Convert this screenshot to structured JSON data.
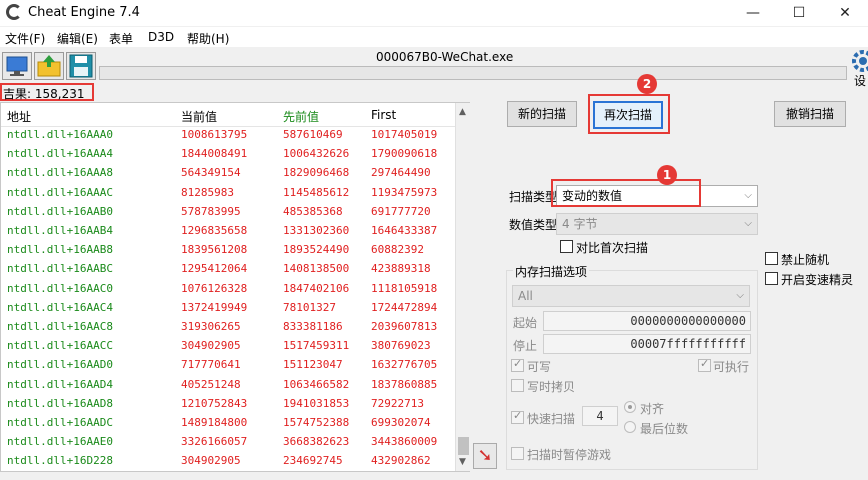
{
  "window": {
    "title": "Cheat Engine 7.4",
    "minimize": "—",
    "maximize": "☐",
    "close": "✕"
  },
  "menu": [
    "文件(F)",
    "编辑(E)",
    "表单",
    "D3D",
    "帮助(H)"
  ],
  "process_title": "000067B0-WeChat.exe",
  "settings_label": "设",
  "results_count": "吉果: 158,231",
  "table": {
    "headers": [
      "地址",
      "当前值",
      "先前值",
      "First"
    ],
    "rows": [
      [
        "ntdll.dll+16AAA0",
        "1008613795",
        "587610469",
        "1017405019"
      ],
      [
        "ntdll.dll+16AAA4",
        "1844008491",
        "1006432626",
        "1790090618"
      ],
      [
        "ntdll.dll+16AAA8",
        "564349154",
        "1829096468",
        "297464490"
      ],
      [
        "ntdll.dll+16AAAC",
        "81285983",
        "1145485612",
        "1193475973"
      ],
      [
        "ntdll.dll+16AAB0",
        "578783995",
        "485385368",
        "691777720"
      ],
      [
        "ntdll.dll+16AAB4",
        "1296835658",
        "1331302360",
        "1646433387"
      ],
      [
        "ntdll.dll+16AAB8",
        "1839561208",
        "1893524490",
        "60882392"
      ],
      [
        "ntdll.dll+16AABC",
        "1295412064",
        "1408138500",
        "423889318"
      ],
      [
        "ntdll.dll+16AAC0",
        "1076126328",
        "1847402106",
        "1118105918"
      ],
      [
        "ntdll.dll+16AAC4",
        "1372419949",
        "78101327",
        "1724472894"
      ],
      [
        "ntdll.dll+16AAC8",
        "319306265",
        "833381186",
        "2039607813"
      ],
      [
        "ntdll.dll+16AACC",
        "304902905",
        "1517459311",
        "380769023"
      ],
      [
        "ntdll.dll+16AAD0",
        "717770641",
        "151123047",
        "1632776705"
      ],
      [
        "ntdll.dll+16AAD4",
        "405251248",
        "1063466582",
        "1837860885"
      ],
      [
        "ntdll.dll+16AAD8",
        "1210752843",
        "1941031853",
        "72922713"
      ],
      [
        "ntdll.dll+16AADC",
        "1489184800",
        "1574752388",
        "699302074"
      ],
      [
        "ntdll.dll+16AAE0",
        "3326166057",
        "3668382623",
        "3443860009"
      ],
      [
        "ntdll.dll+16D228",
        "304902905",
        "234692745",
        "432902862"
      ]
    ]
  },
  "buttons": {
    "new_scan": "新的扫描",
    "next_scan": "再次扫描",
    "undo_scan": "撤销扫描"
  },
  "badges": {
    "one": "1",
    "two": "2"
  },
  "scan": {
    "scan_type_label": "扫描类型",
    "scan_type_value": "变动的数值",
    "value_type_label": "数值类型",
    "value_type_value": "4 字节",
    "compare_first": "对比首次扫描"
  },
  "right_options": {
    "no_random": "禁止随机",
    "speedhack": "开启变速精灵"
  },
  "memory": {
    "group_label": "内存扫描选项",
    "region": "All",
    "start_label": "起始",
    "start_value": "0000000000000000",
    "stop_label": "停止",
    "stop_value": "00007fffffffffff",
    "writable": "可写",
    "executable": "可执行",
    "copy_on_write": "写时拷贝",
    "fast_scan": "快速扫描",
    "fast_scan_value": "4",
    "align": "对齐",
    "last_digits": "最后位数",
    "pause_game": "扫描时暂停游戏"
  },
  "colors": {
    "address": "#1a8a1a",
    "value": "#e02020",
    "highlight": "#e53935",
    "focus": "#2a74d5"
  }
}
